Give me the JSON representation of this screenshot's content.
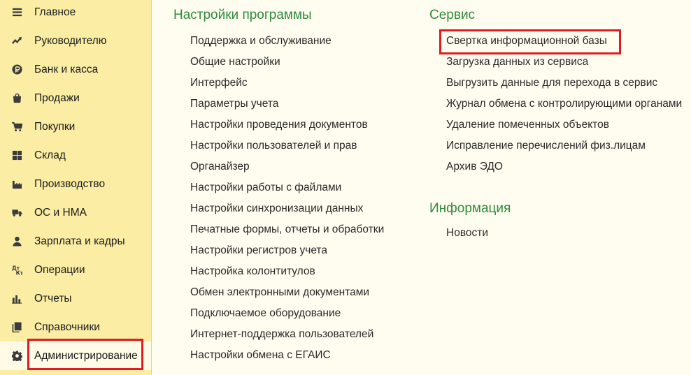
{
  "sidebar": {
    "items": [
      {
        "label": "Главное",
        "icon": "menu-icon"
      },
      {
        "label": "Руководителю",
        "icon": "trend-icon"
      },
      {
        "label": "Банк и касса",
        "icon": "ruble-coin-icon"
      },
      {
        "label": "Продажи",
        "icon": "shopping-bag-icon"
      },
      {
        "label": "Покупки",
        "icon": "cart-icon"
      },
      {
        "label": "Склад",
        "icon": "warehouse-grid-icon"
      },
      {
        "label": "Производство",
        "icon": "factory-icon"
      },
      {
        "label": "ОС и НМА",
        "icon": "truck-icon"
      },
      {
        "label": "Зарплата и кадры",
        "icon": "person-icon"
      },
      {
        "label": "Операции",
        "icon": "dt-kt-icon"
      },
      {
        "label": "Отчеты",
        "icon": "bar-chart-icon"
      },
      {
        "label": "Справочники",
        "icon": "books-icon"
      },
      {
        "label": "Администрирование",
        "icon": "gear-icon"
      }
    ],
    "active_index": 12
  },
  "settings": {
    "title": "Настройки программы",
    "links": [
      "Поддержка и обслуживание",
      "Общие настройки",
      "Интерфейс",
      "Параметры учета",
      "Настройки проведения документов",
      "Настройки пользователей и прав",
      "Органайзер",
      "Настройки работы с файлами",
      "Настройки синхронизации данных",
      "Печатные формы, отчеты и обработки",
      "Настройки регистров учета",
      "Настройка колонтитулов",
      "Обмен электронными документами",
      "Подключаемое оборудование",
      "Интернет-поддержка пользователей",
      "Настройки обмена с ЕГАИС"
    ]
  },
  "service": {
    "title": "Сервис",
    "links": [
      "Свертка информационной базы",
      "Загрузка данных из сервиса",
      "Выгрузить данные для перехода в сервис",
      "Журнал обмена с контролирующими органами",
      "Удаление помеченных объектов",
      "Исправление перечислений физ.лицам",
      "Архив ЭДО"
    ]
  },
  "info": {
    "title": "Информация",
    "links": [
      "Новости"
    ]
  },
  "colors": {
    "sidebar_bg": "#fbeda4",
    "main_bg": "#fffcf0",
    "section_title": "#2e8b3a",
    "highlight_border": "#e01b24"
  }
}
